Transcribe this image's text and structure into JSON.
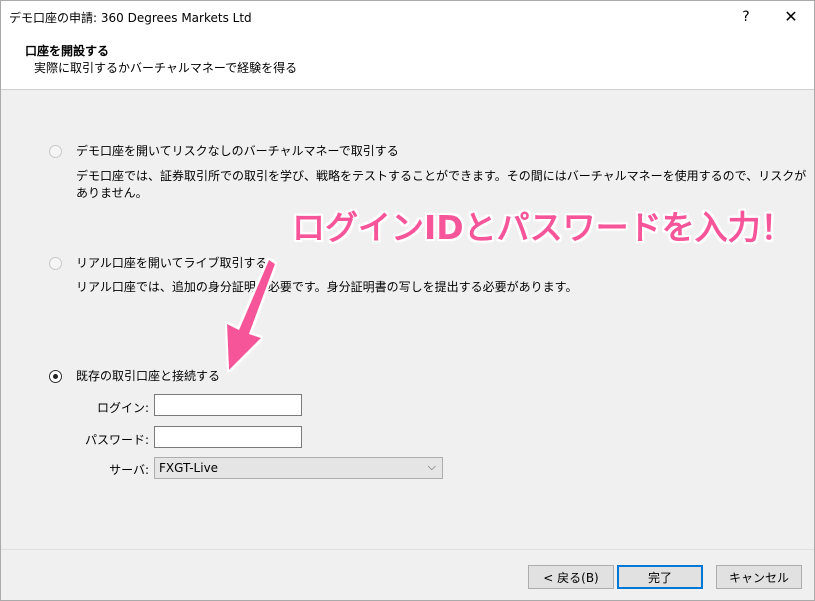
{
  "window": {
    "title": "デモ口座の申請: 360 Degrees Markets Ltd",
    "help_label": "?",
    "close_label": "✕"
  },
  "header": {
    "title": "口座を開設する",
    "subtitle": "実際に取引するかバーチャルマネーで経験を得る"
  },
  "options": [
    {
      "label": "デモ口座を開いてリスクなしのバーチャルマネーで取引する",
      "description": "デモ口座では、証券取引所での取引を学び、戦略をテストすることができます。その間にはバーチャルマネーを使用するので、リスクがありません。",
      "checked": false
    },
    {
      "label": "リアル口座を開いてライブ取引する",
      "description": "リアル口座では、追加の身分証明が必要です。身分証明書の写しを提出する必要があります。",
      "checked": false
    },
    {
      "label": "既存の取引口座と接続する",
      "checked": true
    }
  ],
  "form": {
    "login_label": "ログイン:",
    "login_value": "",
    "password_label": "パスワード:",
    "password_value": "",
    "server_label": "サーバ:",
    "server_value": "FXGT-Live"
  },
  "annotation": {
    "text": "ログインIDとパスワードを入力！",
    "color": "#f7559a"
  },
  "footer": {
    "back_label": "< 戻る(B)",
    "finish_label": "完了",
    "cancel_label": "キャンセル"
  }
}
